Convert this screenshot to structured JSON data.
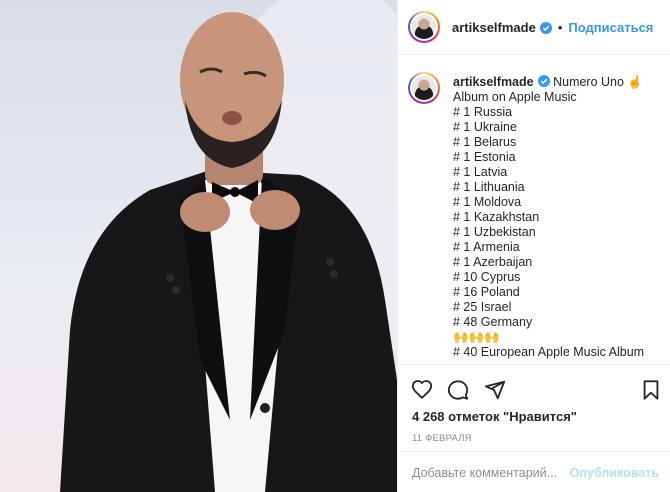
{
  "post": {
    "username": "artikselfmade",
    "follow_label": "Подписаться",
    "dot": "•",
    "caption_lines": [
      "Numero Uno ☝",
      "Album on Apple Music",
      "# 1 Russia",
      "# 1 Ukraine",
      "# 1 Belarus",
      "# 1 Estonia",
      "# 1 Latvia",
      "# 1 Lithuania",
      "# 1 Moldova",
      "# 1 Kazakhstan",
      "# 1 Uzbekistan",
      "# 1 Armenia",
      "# 1 Azerbaijan",
      "# 10 Cyprus",
      "# 16 Poland",
      "# 25 Israel",
      "# 48 Germany",
      "🙌🙌🙌",
      "# 40 European Apple Music Album"
    ],
    "likes_text": "4 268 отметок \"Нравится\"",
    "date_text": "11 ФЕВРАЛЯ",
    "comment_placeholder": "Добавьте комментарий...",
    "publish_label": "Опубликовать"
  },
  "icons": [
    "heart-icon",
    "comment-icon",
    "share-icon",
    "bookmark-icon",
    "verified-badge-icon"
  ],
  "colors": {
    "link_blue": "#3897f0",
    "publish_disabled": "#b2dffc",
    "verified": "#3897f0",
    "text": "#262626",
    "muted": "#8e8e8e"
  }
}
